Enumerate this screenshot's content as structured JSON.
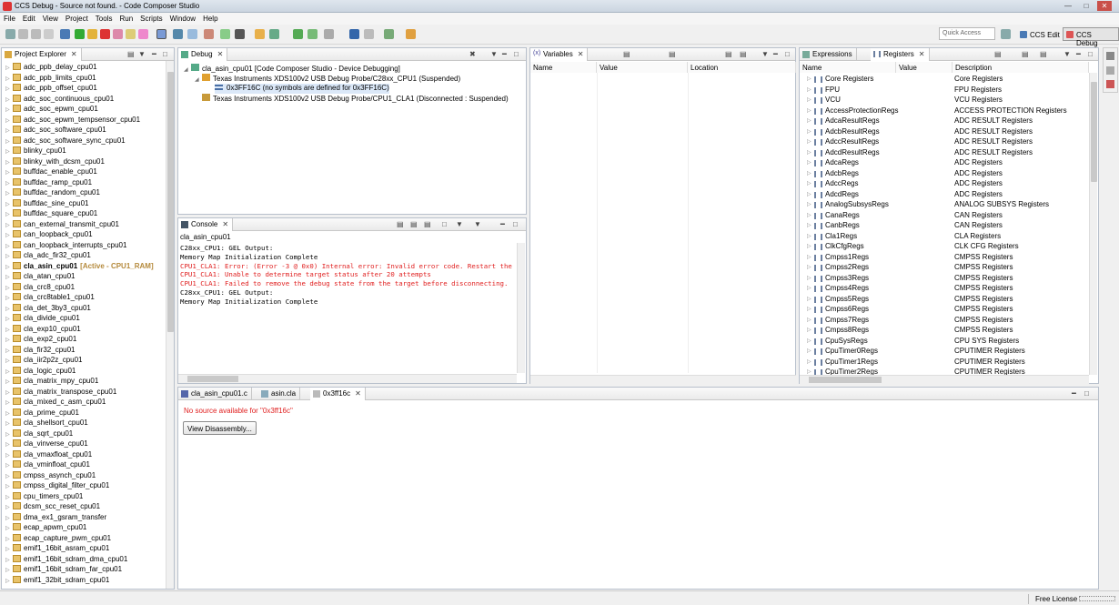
{
  "window": {
    "title": "CCS Debug - Source not found. - Code Composer Studio"
  },
  "menu": [
    "File",
    "Edit",
    "View",
    "Project",
    "Tools",
    "Run",
    "Scripts",
    "Window",
    "Help"
  ],
  "toolbar": {
    "quick_access": "Quick Access",
    "persp_edit": "CCS Edit",
    "persp_debug": "CCS Debug"
  },
  "project_explorer": {
    "tab": "Project Explorer",
    "items": [
      {
        "label": "adc_ppb_delay_cpu01"
      },
      {
        "label": "adc_ppb_limits_cpu01"
      },
      {
        "label": "adc_ppb_offset_cpu01"
      },
      {
        "label": "adc_soc_continuous_cpu01"
      },
      {
        "label": "adc_soc_epwm_cpu01"
      },
      {
        "label": "adc_soc_epwm_tempsensor_cpu01"
      },
      {
        "label": "adc_soc_software_cpu01"
      },
      {
        "label": "adc_soc_software_sync_cpu01"
      },
      {
        "label": "blinky_cpu01"
      },
      {
        "label": "blinky_with_dcsm_cpu01"
      },
      {
        "label": "buffdac_enable_cpu01"
      },
      {
        "label": "buffdac_ramp_cpu01"
      },
      {
        "label": "buffdac_random_cpu01"
      },
      {
        "label": "buffdac_sine_cpu01"
      },
      {
        "label": "buffdac_square_cpu01"
      },
      {
        "label": "can_external_transmit_cpu01"
      },
      {
        "label": "can_loopback_cpu01"
      },
      {
        "label": "can_loopback_interrupts_cpu01"
      },
      {
        "label": "cla_adc_fir32_cpu01"
      },
      {
        "label": "cla_asin_cpu01",
        "active": "[Active - CPU1_RAM]"
      },
      {
        "label": "cla_atan_cpu01"
      },
      {
        "label": "cla_crc8_cpu01"
      },
      {
        "label": "cla_crc8table1_cpu01"
      },
      {
        "label": "cla_det_3by3_cpu01"
      },
      {
        "label": "cla_divide_cpu01"
      },
      {
        "label": "cla_exp10_cpu01"
      },
      {
        "label": "cla_exp2_cpu01"
      },
      {
        "label": "cla_fir32_cpu01"
      },
      {
        "label": "cla_iir2p2z_cpu01"
      },
      {
        "label": "cla_logic_cpu01"
      },
      {
        "label": "cla_matrix_mpy_cpu01"
      },
      {
        "label": "cla_matrix_transpose_cpu01"
      },
      {
        "label": "cla_mixed_c_asm_cpu01"
      },
      {
        "label": "cla_prime_cpu01"
      },
      {
        "label": "cla_shellsort_cpu01"
      },
      {
        "label": "cla_sqrt_cpu01"
      },
      {
        "label": "cla_vinverse_cpu01"
      },
      {
        "label": "cla_vmaxfloat_cpu01"
      },
      {
        "label": "cla_vminfloat_cpu01"
      },
      {
        "label": "cmpss_asynch_cpu01"
      },
      {
        "label": "cmpss_digital_filter_cpu01"
      },
      {
        "label": "cpu_timers_cpu01"
      },
      {
        "label": "dcsm_scc_reset_cpu01"
      },
      {
        "label": "dma_ex1_gsram_transfer"
      },
      {
        "label": "ecap_apwm_cpu01"
      },
      {
        "label": "ecap_capture_pwm_cpu01"
      },
      {
        "label": "emif1_16bit_asram_cpu01"
      },
      {
        "label": "emif1_16bit_sdram_dma_cpu01"
      },
      {
        "label": "emif1_16bit_sdram_far_cpu01"
      },
      {
        "label": "emif1_32bit_sdram_cpu01"
      }
    ]
  },
  "debug": {
    "tab": "Debug",
    "rows": [
      "cla_asin_cpu01 [Code Composer Studio - Device Debugging]",
      "Texas Instruments XDS100v2 USB Debug Probe/C28xx_CPU1 (Suspended)",
      "0x3FF16C  (no symbols are defined for 0x3FF16C)",
      "Texas Instruments XDS100v2 USB Debug Probe/CPU1_CLA1 (Disconnected : Suspended)"
    ]
  },
  "variables": {
    "tab": "Variables",
    "columns": [
      "Name",
      "Value",
      "Location"
    ]
  },
  "registers": {
    "tab_expressions": "Expressions",
    "tab_registers": "Registers",
    "columns": [
      "Name",
      "Value",
      "Description"
    ],
    "rows": [
      {
        "name": "Core Registers",
        "desc": "Core Registers"
      },
      {
        "name": "FPU",
        "desc": "FPU Registers"
      },
      {
        "name": "VCU",
        "desc": "VCU Registers"
      },
      {
        "name": "AccessProtectionRegs",
        "desc": "ACCESS PROTECTION Registers"
      },
      {
        "name": "AdcaResultRegs",
        "desc": "ADC RESULT Registers"
      },
      {
        "name": "AdcbResultRegs",
        "desc": "ADC RESULT Registers"
      },
      {
        "name": "AdccResultRegs",
        "desc": "ADC RESULT Registers"
      },
      {
        "name": "AdcdResultRegs",
        "desc": "ADC RESULT Registers"
      },
      {
        "name": "AdcaRegs",
        "desc": "ADC Registers"
      },
      {
        "name": "AdcbRegs",
        "desc": "ADC Registers"
      },
      {
        "name": "AdccRegs",
        "desc": "ADC Registers"
      },
      {
        "name": "AdcdRegs",
        "desc": "ADC Registers"
      },
      {
        "name": "AnalogSubsysRegs",
        "desc": "ANALOG SUBSYS Registers"
      },
      {
        "name": "CanaRegs",
        "desc": "CAN Registers"
      },
      {
        "name": "CanbRegs",
        "desc": "CAN Registers"
      },
      {
        "name": "Cla1Regs",
        "desc": "CLA Registers"
      },
      {
        "name": "ClkCfgRegs",
        "desc": "CLK CFG Registers"
      },
      {
        "name": "Cmpss1Regs",
        "desc": "CMPSS Registers"
      },
      {
        "name": "Cmpss2Regs",
        "desc": "CMPSS Registers"
      },
      {
        "name": "Cmpss3Regs",
        "desc": "CMPSS Registers"
      },
      {
        "name": "Cmpss4Regs",
        "desc": "CMPSS Registers"
      },
      {
        "name": "Cmpss5Regs",
        "desc": "CMPSS Registers"
      },
      {
        "name": "Cmpss6Regs",
        "desc": "CMPSS Registers"
      },
      {
        "name": "Cmpss7Regs",
        "desc": "CMPSS Registers"
      },
      {
        "name": "Cmpss8Regs",
        "desc": "CMPSS Registers"
      },
      {
        "name": "CpuSysRegs",
        "desc": "CPU SYS Registers"
      },
      {
        "name": "CpuTimer0Regs",
        "desc": "CPUTIMER Registers"
      },
      {
        "name": "CpuTimer1Regs",
        "desc": "CPUTIMER Registers"
      },
      {
        "name": "CpuTimer2Regs",
        "desc": "CPUTIMER Registers"
      }
    ]
  },
  "console": {
    "tab": "Console",
    "header": "cla_asin_cpu01",
    "lines": [
      {
        "text": "C28xx_CPU1: GEL Output:",
        "err": false
      },
      {
        "text": "Memory Map Initialization Complete",
        "err": false
      },
      {
        "text": "CPU1_CLA1: Error: (Error -3 @ 0x0) Internal error: Invalid error code. Restart the",
        "err": true
      },
      {
        "text": "CPU1_CLA1: Unable to determine target status after 20 attempts",
        "err": true
      },
      {
        "text": "CPU1_CLA1: Failed to remove the debug state from the target before disconnecting.",
        "err": true
      },
      {
        "text": "C28xx_CPU1: GEL Output:",
        "err": false
      },
      {
        "text": "Memory Map Initialization Complete",
        "err": false
      }
    ]
  },
  "editor": {
    "tabs": [
      "cla_asin_cpu01.c",
      "asin.cla",
      "0x3ff16c"
    ],
    "message": "No source available for \"0x3ff16c\"",
    "button": "View Disassembly..."
  },
  "status": {
    "license": "Free License"
  }
}
